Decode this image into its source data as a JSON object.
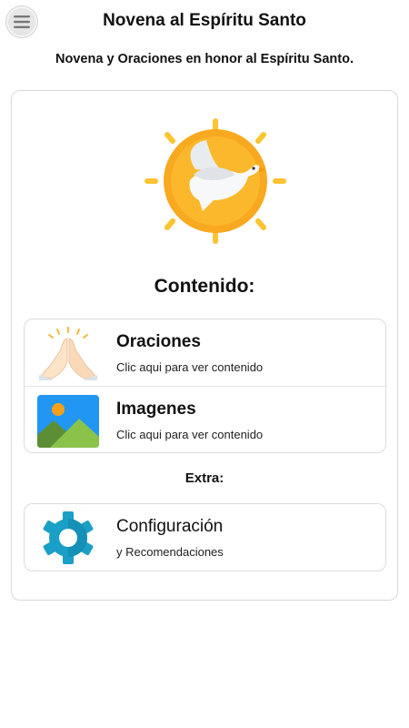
{
  "header": {
    "title": "Novena al Espíritu Santo",
    "subtitle": "Novena y Oraciones en honor al Espíritu Santo.",
    "menu_icon": "hamburger-menu-icon"
  },
  "main": {
    "hero_icon": "dove-sun-icon",
    "section_title": "Contenido:",
    "content_items": [
      {
        "title": "Oraciones",
        "subtitle": "Clic aqui para ver contenido",
        "icon": "praying-hands-icon"
      },
      {
        "title": "Imagenes",
        "subtitle": "Clic aqui para ver contenido",
        "icon": "image-gallery-icon"
      }
    ],
    "extra_label": "Extra:",
    "extra_items": [
      {
        "title": "Configuración",
        "subtitle": "y Recomendaciones",
        "icon": "gear-icon"
      }
    ]
  },
  "colors": {
    "sun": "#f8a91f",
    "sun_rays": "#fbc531",
    "image_sky": "#2196f3",
    "image_hill": "#8bc34a",
    "gear": "#1a9fc7"
  }
}
